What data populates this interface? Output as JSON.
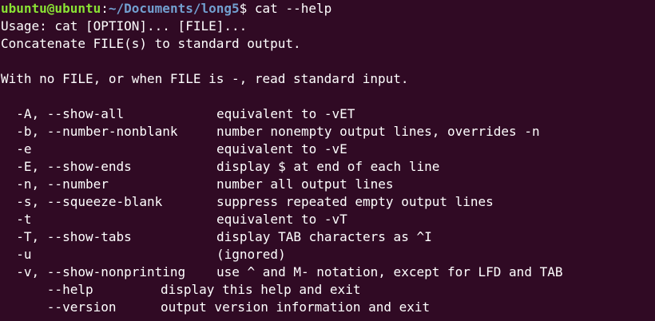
{
  "prompt": {
    "user_host": "ubuntu@ubuntu",
    "colon": ":",
    "path": "~/Documents/long5",
    "dollar": "$",
    "command": " cat --help"
  },
  "usage_line": "Usage: cat [OPTION]... [FILE]...",
  "summary_line": "Concatenate FILE(s) to standard output.",
  "stdin_line": "With no FILE, or when FILE is -, read standard input.",
  "options": [
    {
      "flag": "  -A, --show-all",
      "desc": "equivalent to -vET"
    },
    {
      "flag": "  -b, --number-nonblank",
      "desc": "number nonempty output lines, overrides -n"
    },
    {
      "flag": "  -e",
      "desc": "equivalent to -vE"
    },
    {
      "flag": "  -E, --show-ends",
      "desc": "display $ at end of each line"
    },
    {
      "flag": "  -n, --number",
      "desc": "number all output lines"
    },
    {
      "flag": "  -s, --squeeze-blank",
      "desc": "suppress repeated empty output lines"
    },
    {
      "flag": "  -t",
      "desc": "equivalent to -vT"
    },
    {
      "flag": "  -T, --show-tabs",
      "desc": "display TAB characters as ^I"
    },
    {
      "flag": "  -u",
      "desc": "(ignored)"
    },
    {
      "flag": "  -v, --show-nonprinting",
      "desc": "use ^ and M- notation, except for LFD and TAB"
    }
  ],
  "long_options": [
    {
      "flag": "      --help",
      "desc": "display this help and exit"
    },
    {
      "flag": "      --version",
      "desc": "output version information and exit"
    }
  ],
  "colors": {
    "background": "#300a24",
    "text": "#ffffff",
    "prompt_user": "#8ae234",
    "prompt_path": "#729fcf"
  }
}
